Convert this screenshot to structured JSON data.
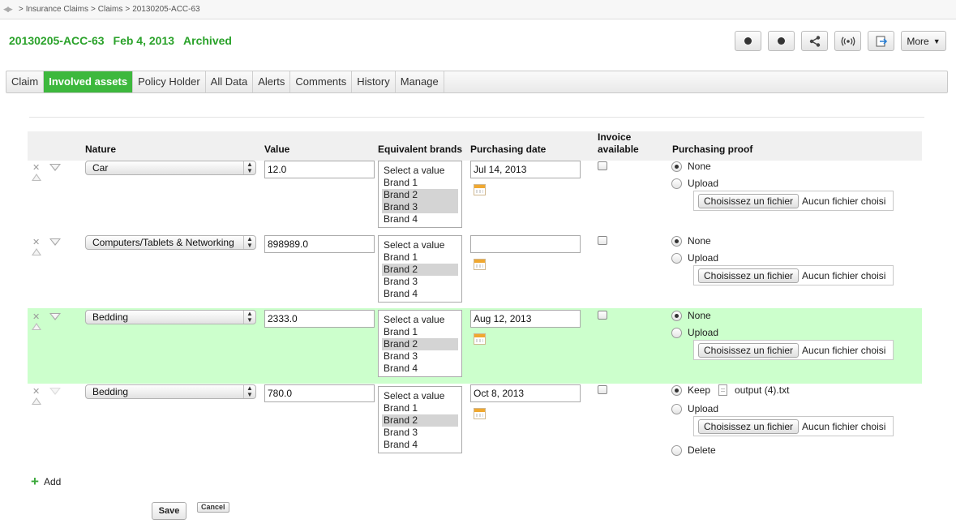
{
  "breadcrumb": {
    "items": [
      "Insurance Claims",
      "Claims",
      "20130205-ACC-63"
    ],
    "sep": ">"
  },
  "title": {
    "id": "20130205-ACC-63",
    "date": "Feb 4, 2013",
    "status": "Archived"
  },
  "toolbar": {
    "more_label": "More"
  },
  "tabs": [
    "Claim",
    "Involved assets",
    "Policy Holder",
    "All Data",
    "Alerts",
    "Comments",
    "History",
    "Manage"
  ],
  "active_tab": "Involved assets",
  "columns": {
    "nature": "Nature",
    "value": "Value",
    "brands": "Equivalent brands",
    "date": "Purchasing date",
    "invoice_1": "Invoice",
    "invoice_2": "available",
    "proof": "Purchasing proof"
  },
  "brand_options": [
    "Select a value",
    "Brand 1",
    "Brand 2",
    "Brand 3",
    "Brand 4"
  ],
  "proof_labels": {
    "none": "None",
    "upload": "Upload",
    "keep": "Keep",
    "delete": "Delete",
    "choose": "Choisissez un fichier",
    "no_file": "Aucun fichier choisi"
  },
  "rows": [
    {
      "nature": "Car",
      "value": "12.0",
      "date": "Jul 14, 2013",
      "selected_brands": [
        "Brand 2",
        "Brand 3"
      ]
    },
    {
      "nature": "Computers/Tablets & Networking",
      "value": "898989.0",
      "date": "",
      "selected_brands": [
        "Brand 2"
      ]
    },
    {
      "nature": "Bedding",
      "value": "2333.0",
      "date": "Aug 12, 2013",
      "selected_brands": [
        "Brand 2"
      ]
    },
    {
      "nature": "Bedding",
      "value": "780.0",
      "date": "Oct 8, 2013",
      "selected_brands": [
        "Brand 2"
      ],
      "kept_file": "output (4).txt"
    }
  ],
  "actions": {
    "add": "Add",
    "save": "Save",
    "cancel": "Cancel"
  },
  "colors": {
    "accent": "#3db83d",
    "highlight": "#ccffcc"
  }
}
